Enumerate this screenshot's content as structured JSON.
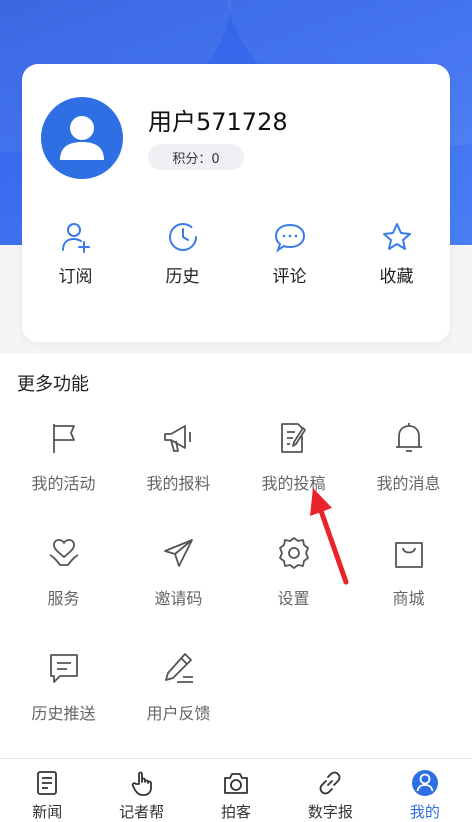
{
  "colors": {
    "accent": "#2f6fe4",
    "arrow": "#e8232a"
  },
  "profile": {
    "username": "用户571728",
    "points_label": "积分：0"
  },
  "quick_actions": [
    {
      "label": "订阅",
      "icon": "user-add-icon"
    },
    {
      "label": "历史",
      "icon": "clock-icon"
    },
    {
      "label": "评论",
      "icon": "comment-icon"
    },
    {
      "label": "收藏",
      "icon": "star-icon"
    }
  ],
  "more": {
    "title": "更多功能",
    "items": [
      {
        "label": "我的活动",
        "icon": "flag-icon"
      },
      {
        "label": "我的报料",
        "icon": "megaphone-icon"
      },
      {
        "label": "我的投稿",
        "icon": "edit-document-icon"
      },
      {
        "label": "我的消息",
        "icon": "bell-icon"
      },
      {
        "label": "服务",
        "icon": "heart-hand-icon"
      },
      {
        "label": "邀请码",
        "icon": "send-icon"
      },
      {
        "label": "设置",
        "icon": "gear-icon"
      },
      {
        "label": "商城",
        "icon": "shopping-bag-icon"
      },
      {
        "label": "历史推送",
        "icon": "message-icon"
      },
      {
        "label": "用户反馈",
        "icon": "pencil-icon"
      }
    ]
  },
  "tabbar": [
    {
      "label": "新闻",
      "icon": "news-icon"
    },
    {
      "label": "记者帮",
      "icon": "hand-pointer-icon"
    },
    {
      "label": "拍客",
      "icon": "camera-icon"
    },
    {
      "label": "数字报",
      "icon": "link-icon"
    },
    {
      "label": "我的",
      "icon": "profile-icon",
      "active": true
    }
  ]
}
